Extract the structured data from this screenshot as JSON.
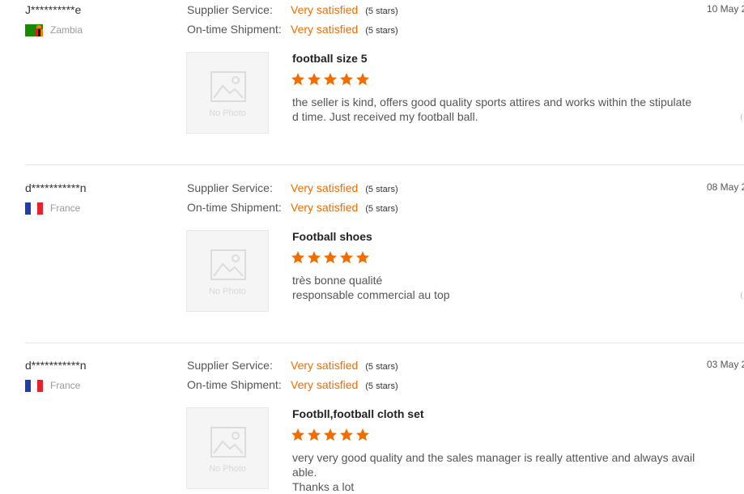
{
  "labels": {
    "supplier_service": "Supplier Service:",
    "ontime_shipment": "On-time Shipment:",
    "no_photo": "No Photo"
  },
  "colors": {
    "accent": "#f26c00",
    "star": "#f26c00",
    "divider": "#e6e6e6"
  },
  "reviews": [
    {
      "buyer": "J**********e",
      "country": "Zambia",
      "flag_icon": "zambia-flag-icon",
      "supplier_service": {
        "value": "Very satisfied",
        "stars": "(5 stars)"
      },
      "ontime_shipment": {
        "value": "Very satisfied",
        "stars": "(5 stars)"
      },
      "date": "10 May 2",
      "product": "football size 5",
      "rating": 5,
      "comment": [
        "the seller is kind, offers good quality sports attires and works within the stipulated time. Just received my football ball."
      ]
    },
    {
      "buyer": "d***********n",
      "country": "France",
      "flag_icon": "france-flag-icon",
      "supplier_service": {
        "value": "Very satisfied",
        "stars": "(5 stars)"
      },
      "ontime_shipment": {
        "value": "Very satisfied",
        "stars": "(5 stars)"
      },
      "date": "08 May 2",
      "product": "Football shoes",
      "rating": 5,
      "comment": [
        "très bonne qualité",
        "responsable commercial au top"
      ]
    },
    {
      "buyer": "d***********n",
      "country": "France",
      "flag_icon": "france-flag-icon",
      "supplier_service": {
        "value": "Very satisfied",
        "stars": "(5 stars)"
      },
      "ontime_shipment": {
        "value": "Very satisfied",
        "stars": "(5 stars)"
      },
      "date": "03 May 2",
      "product": "Footbll,football cloth set",
      "rating": 5,
      "comment": [
        "very very good quality and the sales manager is really attentive and always available.",
        "Thanks a lot"
      ]
    }
  ]
}
